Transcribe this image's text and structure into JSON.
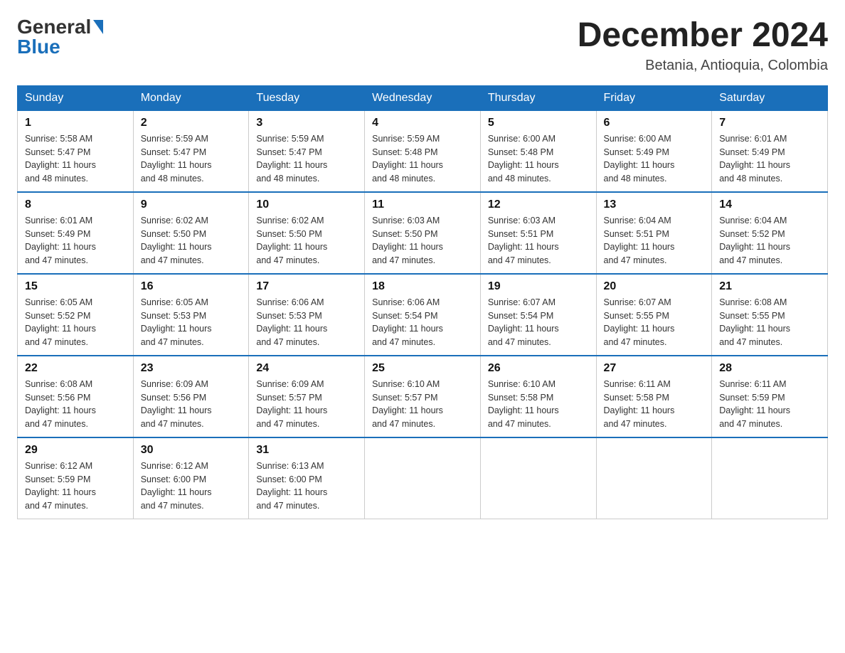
{
  "header": {
    "logo_general": "General",
    "logo_blue": "Blue",
    "month_title": "December 2024",
    "location": "Betania, Antioquia, Colombia"
  },
  "days_of_week": [
    "Sunday",
    "Monday",
    "Tuesday",
    "Wednesday",
    "Thursday",
    "Friday",
    "Saturday"
  ],
  "weeks": [
    [
      {
        "day": "1",
        "sunrise": "Sunrise: 5:58 AM",
        "sunset": "Sunset: 5:47 PM",
        "daylight": "Daylight: 11 hours",
        "daylight2": "and 48 minutes."
      },
      {
        "day": "2",
        "sunrise": "Sunrise: 5:59 AM",
        "sunset": "Sunset: 5:47 PM",
        "daylight": "Daylight: 11 hours",
        "daylight2": "and 48 minutes."
      },
      {
        "day": "3",
        "sunrise": "Sunrise: 5:59 AM",
        "sunset": "Sunset: 5:47 PM",
        "daylight": "Daylight: 11 hours",
        "daylight2": "and 48 minutes."
      },
      {
        "day": "4",
        "sunrise": "Sunrise: 5:59 AM",
        "sunset": "Sunset: 5:48 PM",
        "daylight": "Daylight: 11 hours",
        "daylight2": "and 48 minutes."
      },
      {
        "day": "5",
        "sunrise": "Sunrise: 6:00 AM",
        "sunset": "Sunset: 5:48 PM",
        "daylight": "Daylight: 11 hours",
        "daylight2": "and 48 minutes."
      },
      {
        "day": "6",
        "sunrise": "Sunrise: 6:00 AM",
        "sunset": "Sunset: 5:49 PM",
        "daylight": "Daylight: 11 hours",
        "daylight2": "and 48 minutes."
      },
      {
        "day": "7",
        "sunrise": "Sunrise: 6:01 AM",
        "sunset": "Sunset: 5:49 PM",
        "daylight": "Daylight: 11 hours",
        "daylight2": "and 48 minutes."
      }
    ],
    [
      {
        "day": "8",
        "sunrise": "Sunrise: 6:01 AM",
        "sunset": "Sunset: 5:49 PM",
        "daylight": "Daylight: 11 hours",
        "daylight2": "and 47 minutes."
      },
      {
        "day": "9",
        "sunrise": "Sunrise: 6:02 AM",
        "sunset": "Sunset: 5:50 PM",
        "daylight": "Daylight: 11 hours",
        "daylight2": "and 47 minutes."
      },
      {
        "day": "10",
        "sunrise": "Sunrise: 6:02 AM",
        "sunset": "Sunset: 5:50 PM",
        "daylight": "Daylight: 11 hours",
        "daylight2": "and 47 minutes."
      },
      {
        "day": "11",
        "sunrise": "Sunrise: 6:03 AM",
        "sunset": "Sunset: 5:50 PM",
        "daylight": "Daylight: 11 hours",
        "daylight2": "and 47 minutes."
      },
      {
        "day": "12",
        "sunrise": "Sunrise: 6:03 AM",
        "sunset": "Sunset: 5:51 PM",
        "daylight": "Daylight: 11 hours",
        "daylight2": "and 47 minutes."
      },
      {
        "day": "13",
        "sunrise": "Sunrise: 6:04 AM",
        "sunset": "Sunset: 5:51 PM",
        "daylight": "Daylight: 11 hours",
        "daylight2": "and 47 minutes."
      },
      {
        "day": "14",
        "sunrise": "Sunrise: 6:04 AM",
        "sunset": "Sunset: 5:52 PM",
        "daylight": "Daylight: 11 hours",
        "daylight2": "and 47 minutes."
      }
    ],
    [
      {
        "day": "15",
        "sunrise": "Sunrise: 6:05 AM",
        "sunset": "Sunset: 5:52 PM",
        "daylight": "Daylight: 11 hours",
        "daylight2": "and 47 minutes."
      },
      {
        "day": "16",
        "sunrise": "Sunrise: 6:05 AM",
        "sunset": "Sunset: 5:53 PM",
        "daylight": "Daylight: 11 hours",
        "daylight2": "and 47 minutes."
      },
      {
        "day": "17",
        "sunrise": "Sunrise: 6:06 AM",
        "sunset": "Sunset: 5:53 PM",
        "daylight": "Daylight: 11 hours",
        "daylight2": "and 47 minutes."
      },
      {
        "day": "18",
        "sunrise": "Sunrise: 6:06 AM",
        "sunset": "Sunset: 5:54 PM",
        "daylight": "Daylight: 11 hours",
        "daylight2": "and 47 minutes."
      },
      {
        "day": "19",
        "sunrise": "Sunrise: 6:07 AM",
        "sunset": "Sunset: 5:54 PM",
        "daylight": "Daylight: 11 hours",
        "daylight2": "and 47 minutes."
      },
      {
        "day": "20",
        "sunrise": "Sunrise: 6:07 AM",
        "sunset": "Sunset: 5:55 PM",
        "daylight": "Daylight: 11 hours",
        "daylight2": "and 47 minutes."
      },
      {
        "day": "21",
        "sunrise": "Sunrise: 6:08 AM",
        "sunset": "Sunset: 5:55 PM",
        "daylight": "Daylight: 11 hours",
        "daylight2": "and 47 minutes."
      }
    ],
    [
      {
        "day": "22",
        "sunrise": "Sunrise: 6:08 AM",
        "sunset": "Sunset: 5:56 PM",
        "daylight": "Daylight: 11 hours",
        "daylight2": "and 47 minutes."
      },
      {
        "day": "23",
        "sunrise": "Sunrise: 6:09 AM",
        "sunset": "Sunset: 5:56 PM",
        "daylight": "Daylight: 11 hours",
        "daylight2": "and 47 minutes."
      },
      {
        "day": "24",
        "sunrise": "Sunrise: 6:09 AM",
        "sunset": "Sunset: 5:57 PM",
        "daylight": "Daylight: 11 hours",
        "daylight2": "and 47 minutes."
      },
      {
        "day": "25",
        "sunrise": "Sunrise: 6:10 AM",
        "sunset": "Sunset: 5:57 PM",
        "daylight": "Daylight: 11 hours",
        "daylight2": "and 47 minutes."
      },
      {
        "day": "26",
        "sunrise": "Sunrise: 6:10 AM",
        "sunset": "Sunset: 5:58 PM",
        "daylight": "Daylight: 11 hours",
        "daylight2": "and 47 minutes."
      },
      {
        "day": "27",
        "sunrise": "Sunrise: 6:11 AM",
        "sunset": "Sunset: 5:58 PM",
        "daylight": "Daylight: 11 hours",
        "daylight2": "and 47 minutes."
      },
      {
        "day": "28",
        "sunrise": "Sunrise: 6:11 AM",
        "sunset": "Sunset: 5:59 PM",
        "daylight": "Daylight: 11 hours",
        "daylight2": "and 47 minutes."
      }
    ],
    [
      {
        "day": "29",
        "sunrise": "Sunrise: 6:12 AM",
        "sunset": "Sunset: 5:59 PM",
        "daylight": "Daylight: 11 hours",
        "daylight2": "and 47 minutes."
      },
      {
        "day": "30",
        "sunrise": "Sunrise: 6:12 AM",
        "sunset": "Sunset: 6:00 PM",
        "daylight": "Daylight: 11 hours",
        "daylight2": "and 47 minutes."
      },
      {
        "day": "31",
        "sunrise": "Sunrise: 6:13 AM",
        "sunset": "Sunset: 6:00 PM",
        "daylight": "Daylight: 11 hours",
        "daylight2": "and 47 minutes."
      },
      null,
      null,
      null,
      null
    ]
  ]
}
